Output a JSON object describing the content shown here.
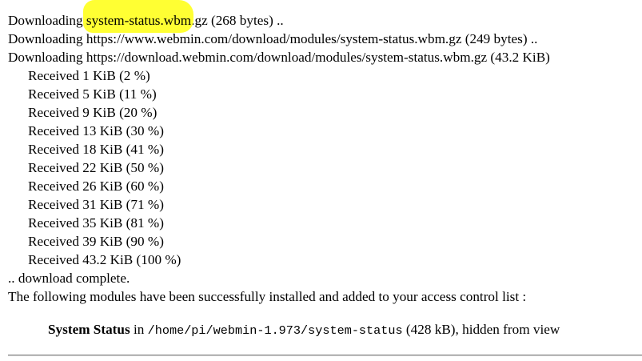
{
  "colors": {
    "highlight": "#ffff33",
    "text": "#000000",
    "rule": "#808080"
  },
  "log": {
    "download_1": {
      "prefix": "Downloading ",
      "highlighted_text": "system-status.wbm",
      "suffix": ".gz (268 bytes) .."
    },
    "download_2": "Downloading https://www.webmin.com/download/modules/system-status.wbm.gz (249 bytes) ..",
    "download_3": "Downloading https://download.webmin.com/download/modules/system-status.wbm.gz (43.2 KiB)",
    "progress": [
      "Received 1 KiB (2 %)",
      "Received 5 KiB (11 %)",
      "Received 9 KiB (20 %)",
      "Received 13 KiB (30 %)",
      "Received 18 KiB (41 %)",
      "Received 22 KiB (50 %)",
      "Received 26 KiB (60 %)",
      "Received 31 KiB (71 %)",
      "Received 35 KiB (81 %)",
      "Received 39 KiB (90 %)",
      "Received 43.2 KiB (100 %)"
    ],
    "complete": ".. download complete.",
    "installed_message": "The following modules have been successfully installed and added to your access control list :"
  },
  "module": {
    "name": "System Status",
    "in_label": " in ",
    "path": "/home/pi/webmin-1.973/system-status",
    "details": " (428 kB), hidden from view"
  }
}
